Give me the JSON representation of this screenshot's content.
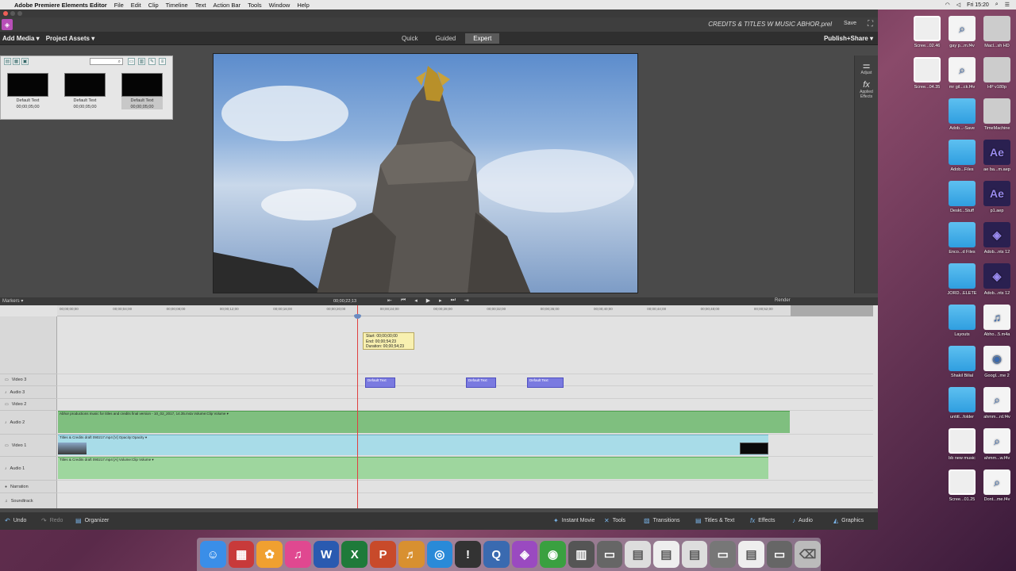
{
  "menubar": {
    "app_name": "Adobe Premiere Elements Editor",
    "menus": [
      "File",
      "Edit",
      "Clip",
      "Timeline",
      "Text",
      "Action Bar",
      "Tools",
      "Window",
      "Help"
    ],
    "clock": "Fri 15:20"
  },
  "header": {
    "project_name": "CREDITS & TITLES W MUSIC ABHOR.prel",
    "save_label": "Save"
  },
  "modebar": {
    "add_media": "Add Media ▾",
    "project_assets": "Project Assets ▾",
    "tabs": [
      "Quick",
      "Guided",
      "Expert"
    ],
    "active_tab": "Expert",
    "publish": "Publish+Share ▾"
  },
  "assets": {
    "tiles": [
      {
        "label": "Default Text",
        "time": "00;00;05;00"
      },
      {
        "label": "Default Text",
        "time": "00;00;05;00"
      },
      {
        "label": "Default Text",
        "time": "00;00;05;00"
      }
    ]
  },
  "rightbar": {
    "adjust": "Adjust",
    "applied_effects": "Applied Effects"
  },
  "timeline": {
    "markers": "Markers ▾",
    "timecode": "00;00;22;13",
    "render": "Render",
    "ruler_ticks": [
      "00;00;00;00",
      "00;00;04;00",
      "00;00;08;00",
      "00;00;12;00",
      "00;00;16;00",
      "00;00;20;00",
      "00;00;24;00",
      "00;00;28;00",
      "00;00;32;00",
      "00;00;36;00",
      "00;00;40;00",
      "00;00;44;00",
      "00;00;48;00",
      "00;00;52;00",
      "00;00;56;00"
    ],
    "tooltip": {
      "start": "Start: 00;00;00;00",
      "end": "End: 00;00;54;23",
      "duration": "Duration: 00;00;54;23"
    },
    "tracks": [
      "Video 3",
      "Audio 3",
      "Video 2",
      "Audio 2",
      "Video 1",
      "Audio 1",
      "Narration",
      "Soundtrack"
    ],
    "title_clips": [
      "Default Text",
      "Default Text",
      "Default Text"
    ],
    "audio2_clip": "Abhor productions music for titles and credits final version - 10_02_2017, 14.35.m4a  Volume:Clip Volume ▾",
    "video1_clip": "Titles & Credits draft 090217.mp4 [V]  Opacity:Opacity ▾",
    "audio1_clip": "Titles & Credits draft 090217.mp4 [A]  Volume:Clip Volume ▾"
  },
  "bottombar": {
    "undo": "Undo",
    "redo": "Redo",
    "organizer": "Organizer",
    "instant_movie": "Instant Movie",
    "tools": "Tools",
    "transitions": "Transitions",
    "titles_text": "Titles & Text",
    "effects": "Effects",
    "audio": "Audio",
    "graphics": "Graphics"
  },
  "desktop": [
    {
      "label": "Scree...02.46",
      "kind": "shot"
    },
    {
      "label": "gay p...m.f4v",
      "kind": "file"
    },
    {
      "label": "Macl...sh HD",
      "kind": "drive"
    },
    {
      "label": "Scree...04.35",
      "kind": "shot"
    },
    {
      "label": "mr gil...ck.f4v",
      "kind": "file"
    },
    {
      "label": "HP v180p",
      "kind": "drive"
    },
    {
      "label": "Adob...-Save",
      "kind": "folder"
    },
    {
      "label": "TimeMachine",
      "kind": "drive"
    },
    {
      "label": "Adob...Files",
      "kind": "folder"
    },
    {
      "label": "ae ba...m.aep",
      "kind": "ae"
    },
    {
      "label": "Deskt...Stuff",
      "kind": "folder"
    },
    {
      "label": "p1.aep",
      "kind": "ae"
    },
    {
      "label": "Enco...d Files",
      "kind": "folder"
    },
    {
      "label": "Adob...nts 12",
      "kind": "app"
    },
    {
      "label": "JORD...ELETE",
      "kind": "folder"
    },
    {
      "label": "Adob...nts 12",
      "kind": "app"
    },
    {
      "label": "Layouts",
      "kind": "folder"
    },
    {
      "label": "Abho...5.m4a",
      "kind": "audio"
    },
    {
      "label": "Shakil Bilial",
      "kind": "folder"
    },
    {
      "label": "Googl...me 2",
      "kind": "chrome"
    },
    {
      "label": "untitl...folder",
      "kind": "folder"
    },
    {
      "label": "ahmm...rd.f4v",
      "kind": "file"
    },
    {
      "label": "bb new music",
      "kind": "shot"
    },
    {
      "label": "ahmm...w.f4v",
      "kind": "file"
    },
    {
      "label": "Scree...01.25",
      "kind": "shot"
    },
    {
      "label": "Dont...me.f4v",
      "kind": "file"
    }
  ],
  "dock_icons": [
    "finder-icon",
    "photo-booth-icon",
    "photos-icon",
    "itunes-icon",
    "word-icon",
    "excel-icon",
    "powerpoint-icon",
    "garageband-icon",
    "safari-icon",
    "warning-app-icon",
    "quicktime-icon",
    "premiere-elements-icon",
    "chrome-icon",
    "mixer-icon",
    "screenshot-icon",
    "document-icon",
    "document-icon",
    "document-icon",
    "screenshot-icon",
    "document-icon",
    "screenshot-icon",
    "trash-icon"
  ],
  "colors": {
    "accent": "#b84fb8",
    "playhead": "#e04040",
    "title_clip": "#7a7ae0",
    "audio_clip": "#7fbf7f",
    "video_clip": "#a8dce8"
  }
}
